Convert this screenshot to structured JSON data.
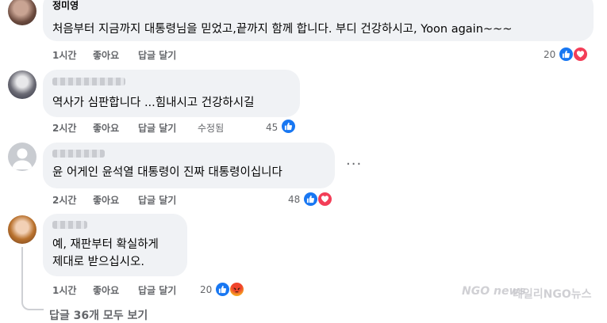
{
  "comments": [
    {
      "author": "정미영",
      "text": "처음부터 지금까지 대통령님을 믿었고,끝까지 함께 합니다. 부디 건강하시고, Yoon again~~~",
      "time": "1시간",
      "like_label": "좋아요",
      "reply_label": "답글 달기",
      "reaction_count": "20"
    },
    {
      "text": "역사가 심판합니다 ...힘내시고 건강하시길",
      "time": "2시간",
      "like_label": "좋아요",
      "reply_label": "답글 달기",
      "edited_label": "수정됨",
      "reaction_count": "45"
    },
    {
      "text": "윤 어게인 윤석열 대통령이 진짜 대통령이십니다",
      "time": "2시간",
      "like_label": "좋아요",
      "reply_label": "답글 달기",
      "reaction_count": "48",
      "more_label": "···"
    },
    {
      "text_line1": "예, 재판부터 확실하게",
      "text_line2": "제대로 받으십시오.",
      "time": "1시간",
      "like_label": "좋아요",
      "reply_label": "답글 달기",
      "reaction_count": "20"
    }
  ],
  "view_all_replies": "답글 36개 모두 보기",
  "watermark": "데일리NGO뉴스",
  "watermark_logo": "NGO news",
  "colors": {
    "like": "#1877f2",
    "love": "#f33e58",
    "angry": "#f5a623",
    "bubble": "#f0f2f5",
    "meta": "#65676b"
  },
  "icons": [
    "like-icon",
    "love-icon",
    "angry-icon"
  ]
}
